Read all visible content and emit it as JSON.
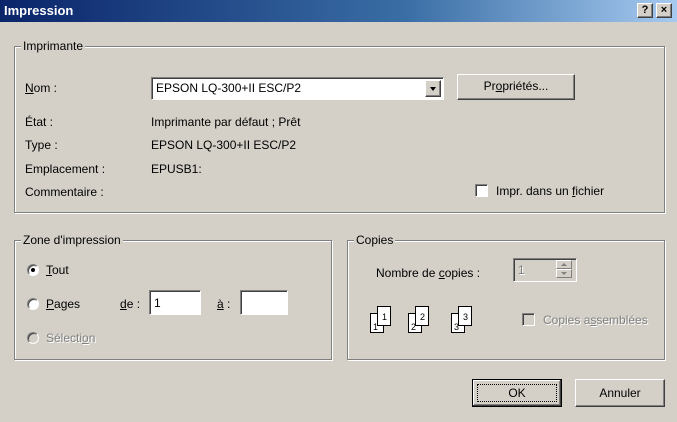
{
  "window": {
    "title": "Impression",
    "help_button": "?",
    "close_button": "×"
  },
  "printer": {
    "legend": "Imprimante",
    "name_label_u": "N",
    "name_label_rest": "om :",
    "name_value": "EPSON LQ-300+II ESC/P2",
    "properties_u": "o",
    "properties_pre": "Pr",
    "properties_post": "priétés...",
    "status_label": "État :",
    "status_value": "Imprimante par défaut ; Prêt",
    "type_label": "Type :",
    "type_value": "EPSON LQ-300+II ESC/P2",
    "location_label": "Emplacement :",
    "location_value": "EPUSB1:",
    "comment_label": "Commentaire :",
    "print_to_file_pre": "Impr. dans un ",
    "print_to_file_u": "f",
    "print_to_file_post": "ichier",
    "print_to_file_checked": false
  },
  "range": {
    "legend": "Zone d'impression",
    "all_u": "T",
    "all_rest": "out",
    "pages_u": "P",
    "pages_rest": "ages",
    "from_u": "d",
    "from_rest": "e :",
    "from_value": "1",
    "to_u": "à",
    "to_rest": " :",
    "to_value": "",
    "selection_pre": "Sélecti",
    "selection_u": "o",
    "selection_post": "n",
    "selected": "all"
  },
  "copies": {
    "legend": "Copies",
    "count_label_pre": "Nombre de ",
    "count_label_u": "c",
    "count_label_post": "opies :",
    "count_value": "1",
    "collate_pre": "Copies a",
    "collate_u": "s",
    "collate_post": "semblées",
    "collate_checked": false,
    "collate_pages": [
      "1",
      "1",
      "2",
      "2",
      "3",
      "3"
    ]
  },
  "buttons": {
    "ok": "OK",
    "cancel": "Annuler"
  }
}
